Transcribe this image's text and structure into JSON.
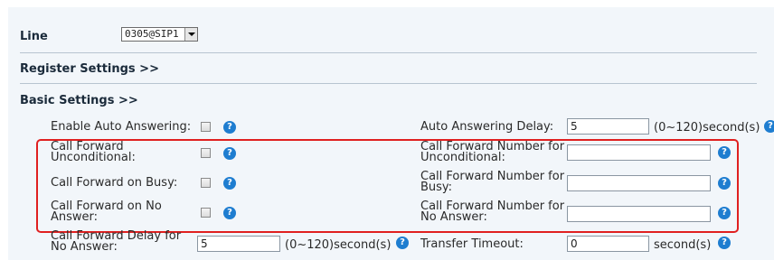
{
  "line": {
    "label": "Line",
    "value": "0305@SIP1"
  },
  "sections": {
    "register": "Register Settings >>",
    "basic": "Basic Settings >>"
  },
  "help_glyph": "?",
  "colors": {
    "highlight_border": "#e02020",
    "help_icon": "#1e7dd0",
    "panel_bg": "#f2f6fa"
  },
  "basic_settings": {
    "enable_auto_answering": {
      "label": "Enable Auto Answering:"
    },
    "auto_answering_delay": {
      "label": "Auto Answering Delay:",
      "value": "5",
      "unit": "(0~120)second(s)"
    },
    "call_forward_unconditional": {
      "label": "Call Forward Unconditional:"
    },
    "cf_number_unconditional": {
      "label": "Call Forward Number for Unconditional:",
      "value": ""
    },
    "call_forward_busy": {
      "label": "Call Forward on Busy:"
    },
    "cf_number_busy": {
      "label": "Call Forward Number for Busy:",
      "value": ""
    },
    "call_forward_no_answer": {
      "label": "Call Forward on No Answer:"
    },
    "cf_number_no_answer": {
      "label": "Call Forward Number for No Answer:",
      "value": ""
    },
    "cf_delay_no_answer": {
      "label": "Call Forward Delay for No Answer:",
      "value": "5",
      "unit": "(0~120)second(s)"
    },
    "transfer_timeout": {
      "label": "Transfer Timeout:",
      "value": "0",
      "unit": "second(s)"
    }
  }
}
